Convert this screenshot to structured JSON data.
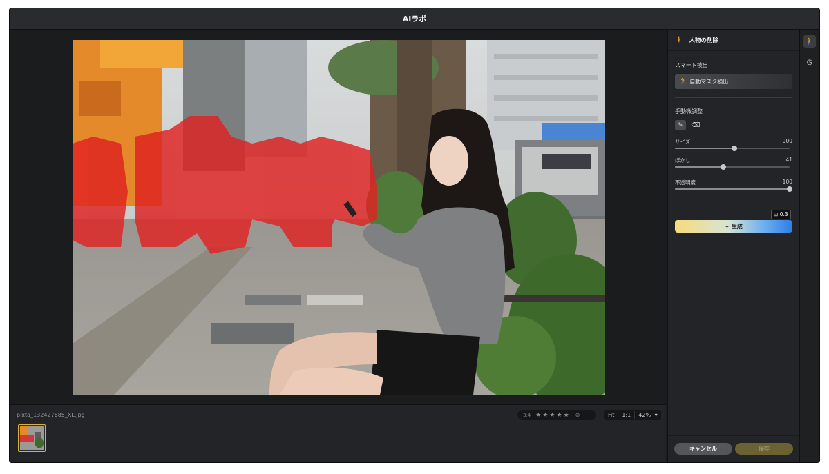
{
  "window": {
    "title": "AIラボ"
  },
  "bottom": {
    "filename": "pixta_132427685_XL.jpg",
    "rating_pill": {
      "label": "3:4",
      "stars": [
        "★",
        "★",
        "★",
        "★",
        "★"
      ]
    },
    "zoom": {
      "fit": "Fit",
      "one_to_one": "1:1",
      "level": "42%",
      "chevron": "▾"
    }
  },
  "panel": {
    "title": "人物の削除",
    "smart_detect": {
      "title": "スマート検出",
      "button": "自動マスク検出"
    },
    "manual": {
      "title": "手動微調整",
      "sliders": [
        {
          "label": "サイズ",
          "value": "900",
          "fraction": 0.52
        },
        {
          "label": "ぼかし",
          "value": "41",
          "fraction": 0.42
        },
        {
          "label": "不透明度",
          "value": "100",
          "fraction": 1.0
        }
      ]
    },
    "generate": {
      "label": "生成",
      "cost": "0.3"
    },
    "cancel": "キャンセル",
    "save": "保存"
  },
  "colors": {
    "accent_yellow": "#d8b23a",
    "mask_red": "#e02222",
    "gradient_start": "#f6dc7a",
    "gradient_end": "#2f7de8"
  },
  "icons": {
    "person_remove": "walking-person-icon",
    "history": "clock-icon",
    "brush": "brush-icon",
    "eraser": "eraser-icon",
    "sparkle": "sparkle-icon"
  }
}
